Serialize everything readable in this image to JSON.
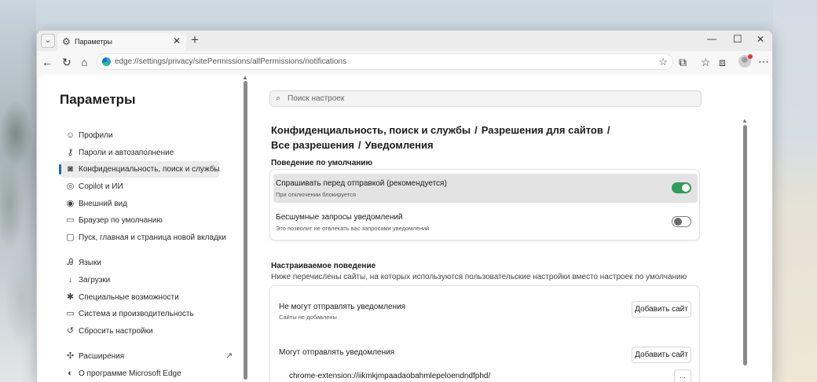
{
  "window": {
    "tab_title": "Параметры",
    "url": "edge://settings/privacy/sitePermissions/allPermissions/notifications",
    "icons": {
      "tab_menu": "chevron-down-icon",
      "tab": "gear-icon",
      "close": "close-icon",
      "new_tab": "plus-icon",
      "back": "back-arrow-icon",
      "refresh": "refresh-icon",
      "home": "home-icon",
      "favorite": "star-icon",
      "extensions": "puzzle-icon",
      "favorites": "favorites-list-icon",
      "collections": "collections-icon",
      "menu": "more-icon"
    }
  },
  "sidebar": {
    "title": "Параметры",
    "items": [
      {
        "label": "Профили",
        "icon": "profile-icon"
      },
      {
        "label": "Пароли и автозаполнение",
        "icon": "key-icon"
      },
      {
        "label": "Конфиденциальность, поиск и службы",
        "icon": "lock-icon",
        "active": true
      },
      {
        "label": "Copilot и ИИ",
        "icon": "copilot-icon"
      },
      {
        "label": "Внешний вид",
        "icon": "eye-icon"
      },
      {
        "label": "Браузер по умолчанию",
        "icon": "browser-icon"
      },
      {
        "label": "Пуск, главная и страница новой вкладки",
        "icon": "new-tab-page-icon"
      },
      {
        "label": "Языки",
        "icon": "languages-icon"
      },
      {
        "label": "Загрузки",
        "icon": "download-icon"
      },
      {
        "label": "Специальные возможности",
        "icon": "accessibility-icon"
      },
      {
        "label": "Система и производительность",
        "icon": "laptop-icon"
      },
      {
        "label": "Сбросить настройки",
        "icon": "reset-icon"
      },
      {
        "label": "Расширения",
        "icon": "puzzle-icon"
      },
      {
        "label": "О программе Microsoft Edge",
        "icon": "edge-logo-icon"
      }
    ]
  },
  "main": {
    "search_placeholder": "Поиск настроек",
    "breadcrumb": [
      "Конфиденциальность, поиск и службы",
      "Разрешения для сайтов",
      "Все разрешения",
      "Уведомления"
    ],
    "breadcrumb_sep": "/",
    "default_behavior": {
      "heading": "Поведение по умолчанию",
      "rows": [
        {
          "label": "Спрашивать перед отправкой (рекомендуется)",
          "sub": "При отключении блокируется",
          "on": true
        },
        {
          "label": "Бесшумные запросы уведомлений",
          "sub": "Это позволит не отвлекать вас запросами уведомлений",
          "on": false
        }
      ]
    },
    "custom_behavior": {
      "heading": "Настраиваемое поведение",
      "subtitle": "Ниже перечислены сайты, на которых используются пользовательские настройки вместо настроек по умолчанию",
      "block": {
        "label": "Не могут отправлять уведомления",
        "sub": "Сайты не добавлены",
        "button": "Добавить сайт"
      },
      "allow": {
        "label": "Могут отправлять уведомления",
        "button": "Добавить сайт",
        "sites": [
          "chrome-extension://iikmkjmpaadaobahmlepeloendndfphd/"
        ]
      },
      "more_label": "..."
    }
  },
  "colors": {
    "accent": "#0f6cbd",
    "toggle_on": "#2e9c5a"
  }
}
